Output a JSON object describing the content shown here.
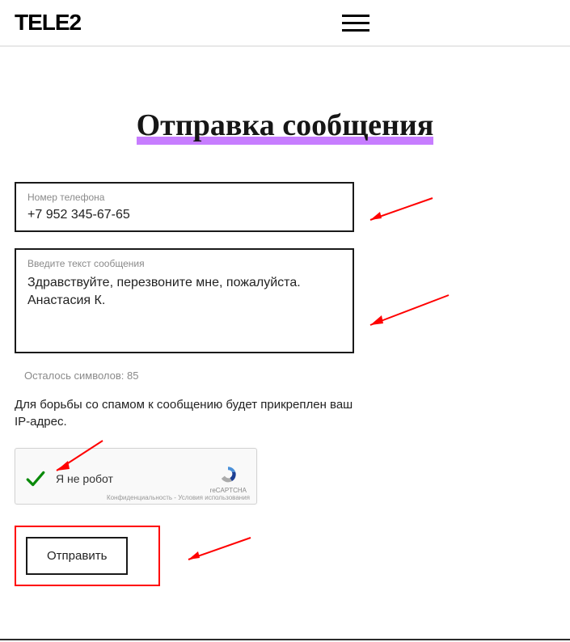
{
  "header": {
    "logo": "TELE2"
  },
  "page": {
    "title": "Отправка сообщения"
  },
  "form": {
    "phone": {
      "label": "Номер телефона",
      "value": "+7 952 345-67-65"
    },
    "message": {
      "label": "Введите текст сообщения",
      "value": "Здравствуйте, перезвоните мне, пожалуйста. Анастасия К."
    },
    "chars_left": "Осталось символов: 85",
    "notice": "Для борьбы со спамом к сообщению будет прикреплен ваш IP-адрес.",
    "captcha": {
      "label": "Я не робот",
      "brand": "reCAPTCHA",
      "terms": "Конфиденциальность - Условия использования"
    },
    "submit": "Отправить"
  }
}
